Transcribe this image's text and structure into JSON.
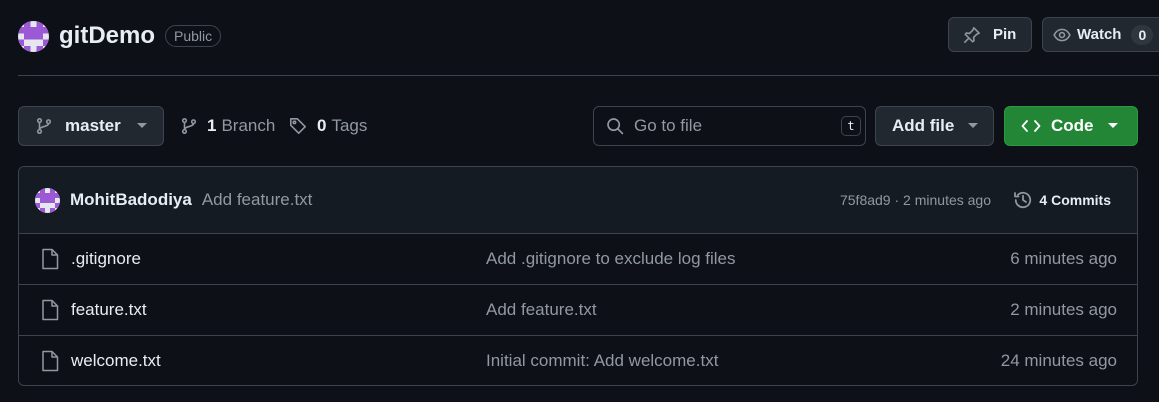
{
  "repo": {
    "name": "gitDemo",
    "visibility": "Public"
  },
  "header_actions": {
    "pin_label": "Pin",
    "watch_label": "Watch",
    "watch_count": "0"
  },
  "toolbar": {
    "branch": "master",
    "branch_count": "1",
    "branch_label": "Branch",
    "tag_count": "0",
    "tag_label": "Tags",
    "search_placeholder": "Go to file",
    "search_shortcut": "t",
    "add_file_label": "Add file",
    "code_label": "Code"
  },
  "latest_commit": {
    "author": "MohitBadodiya",
    "message": "Add feature.txt",
    "sha": "75f8ad9",
    "separator": " · ",
    "time": "2 minutes ago",
    "commits_label": "4 Commits"
  },
  "files": [
    {
      "name": ".gitignore",
      "commit": "Add .gitignore to exclude log files",
      "time": "6 minutes ago"
    },
    {
      "name": "feature.txt",
      "commit": "Add feature.txt",
      "time": "2 minutes ago"
    },
    {
      "name": "welcome.txt",
      "commit": "Initial commit: Add welcome.txt",
      "time": "24 minutes ago"
    }
  ],
  "colors": {
    "background": "#0d1117",
    "border": "#3d444d",
    "code_button": "#238636",
    "avatar_identicon": "#a371f7"
  },
  "icons": [
    "identicon-avatar",
    "pin-icon",
    "eye-icon",
    "git-branch-icon",
    "tag-icon",
    "search-icon",
    "code-icon",
    "history-icon",
    "file-icon",
    "caret-down-icon"
  ]
}
